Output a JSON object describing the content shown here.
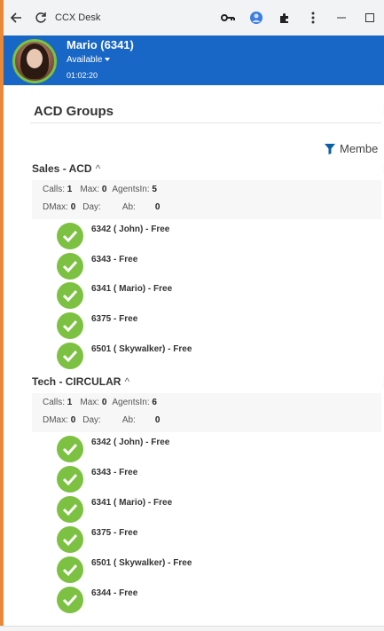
{
  "browser": {
    "title": "CCX Desk"
  },
  "agent": {
    "name": "Mario (6341)",
    "status": "Available",
    "timer": "01:02:20"
  },
  "page": {
    "title": "ACD Groups",
    "filter_label": "Membe"
  },
  "groups": [
    {
      "name": "Sales - ACD",
      "stats": {
        "calls_label": "Calls:",
        "calls": "1",
        "max_label": "Max:",
        "max": "0",
        "agentsin_label": "AgentsIn:",
        "agentsin": "5",
        "dmax_label": "DMax:",
        "dmax": "0",
        "day_label": "Day:",
        "day": "",
        "ab_label": "Ab:",
        "ab": "0"
      },
      "members": [
        {
          "label": "6342 ( John)  -  Free"
        },
        {
          "label": "6343  -  Free"
        },
        {
          "label": "6341 ( Mario)  -  Free"
        },
        {
          "label": "6375  -  Free"
        },
        {
          "label": "6501 ( Skywalker)  -  Free"
        }
      ]
    },
    {
      "name": "Tech - CIRCULAR",
      "stats": {
        "calls_label": "Calls:",
        "calls": "1",
        "max_label": "Max:",
        "max": "0",
        "agentsin_label": "AgentsIn:",
        "agentsin": "6",
        "dmax_label": "DMax:",
        "dmax": "0",
        "day_label": "Day:",
        "day": "",
        "ab_label": "Ab:",
        "ab": "0"
      },
      "members": [
        {
          "label": "6342 ( John)  -  Free"
        },
        {
          "label": "6343  -  Free"
        },
        {
          "label": "6341 ( Mario)  -  Free"
        },
        {
          "label": "6375  -  Free"
        },
        {
          "label": "6501 ( Skywalker)  -  Free"
        },
        {
          "label": "6344  -  Free"
        }
      ]
    }
  ],
  "colors": {
    "header_blue": "#1866c5",
    "available_green": "#7cc142",
    "frame_orange": "#e8893a"
  }
}
